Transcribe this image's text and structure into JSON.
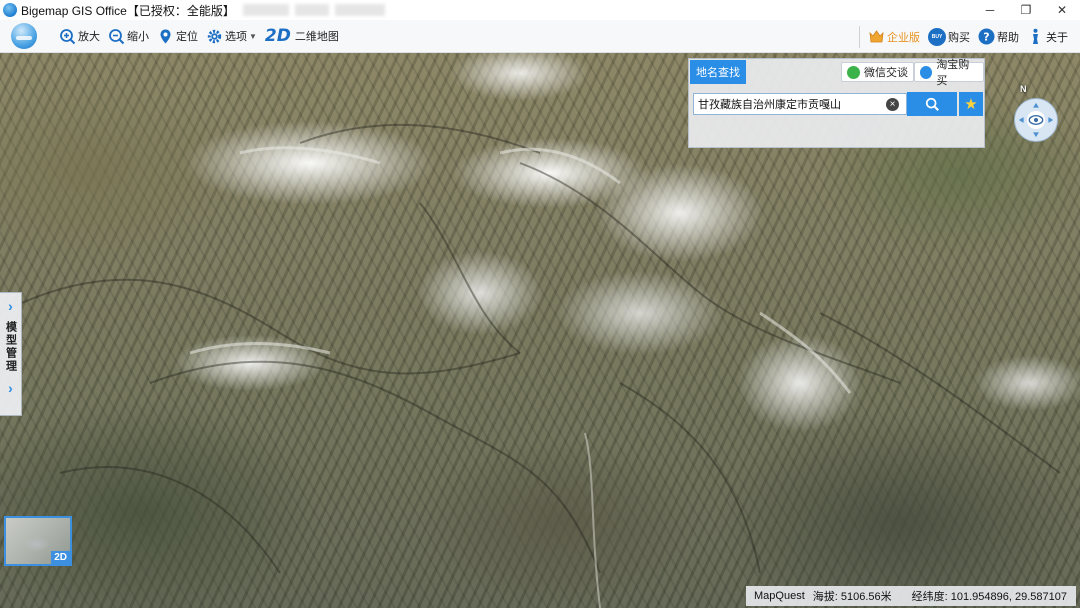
{
  "window": {
    "title": "Bigemap GIS Office【已授权：全能版】",
    "controls": {
      "minimize": "─",
      "restore": "❐",
      "close": "✕"
    }
  },
  "toolbar": {
    "zoom_in": "放大",
    "zoom_out": "缩小",
    "locate": "定位",
    "options": "选项",
    "mode_2d_badge": "2D",
    "mode_2d": "二维地图",
    "enterprise": "企业版",
    "buy": "购买",
    "help": "帮助",
    "about": "关于",
    "buy_badge": "BUY"
  },
  "search_panel": {
    "tab_label": "地名查找",
    "wechat_label": "微信交谈",
    "taobao_label": "淘宝购买",
    "query_value": "甘孜藏族自治州康定市贡嘎山",
    "clear_icon": "×",
    "favorite_icon": "★"
  },
  "compass": {
    "north_label": "N"
  },
  "side_panel": {
    "label": "模型管理",
    "arrow_top": "›",
    "arrow_bottom": "›"
  },
  "minimap": {
    "mode_label": "2D"
  },
  "status": {
    "provider": "MapQuest",
    "altitude": "海拔: 5106.56米",
    "coordinates": "经纬度:  101.954896, 29.587107"
  },
  "colors": {
    "accent": "#2b8ee6",
    "enterprise": "#e89422"
  }
}
